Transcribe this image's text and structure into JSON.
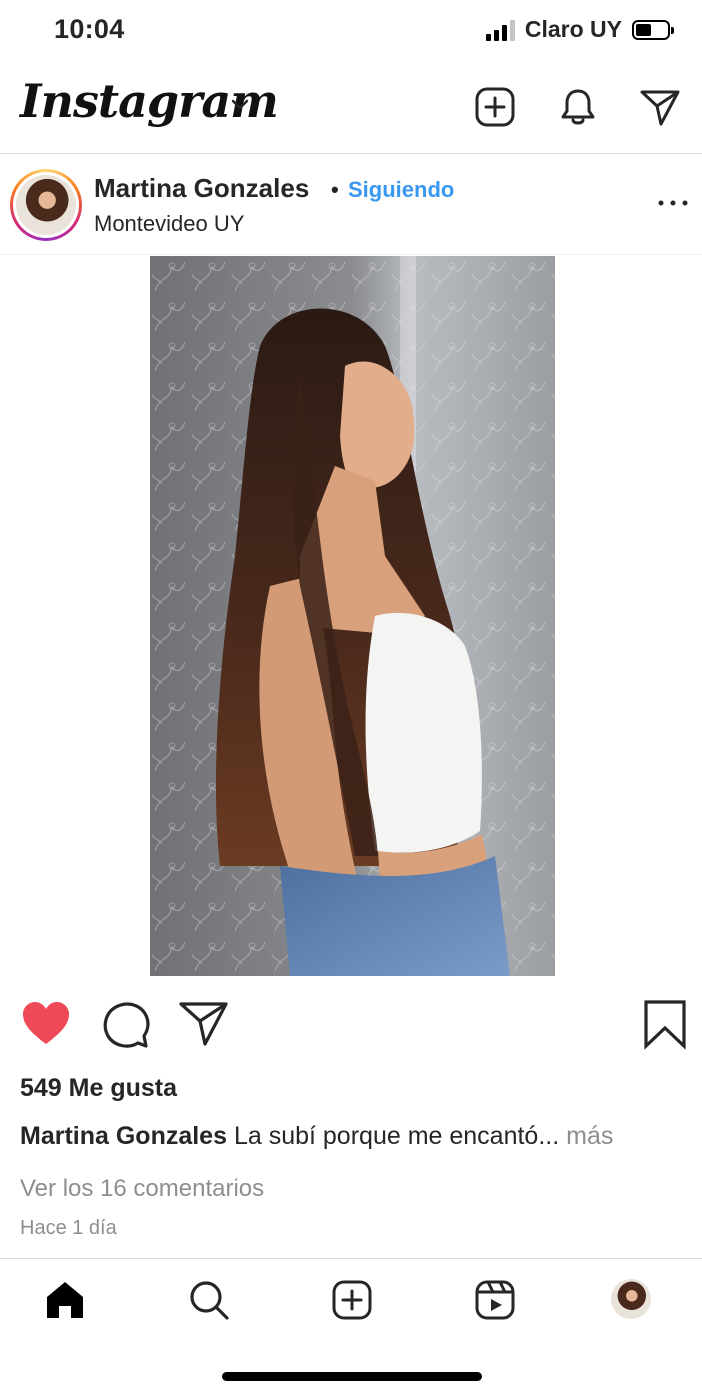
{
  "status_bar": {
    "time": "10:04",
    "carrier": "Claro UY",
    "battery_level_percent": 50
  },
  "header": {
    "logo_text": "Instagram",
    "icons": [
      "new-post-icon",
      "notifications-icon",
      "direct-messages-icon"
    ]
  },
  "post": {
    "username": "Martina Gonzales",
    "separator": "•",
    "follow_status": "Siguiendo",
    "location": "Montevideo UY",
    "likes": "549 Me gusta",
    "caption_user": "Martina Gonzales",
    "caption_text": "La subí porque me encantó...",
    "caption_more": "más",
    "comments_link": "Ver los 16 comentarios",
    "time_ago": "Hace 1 día",
    "liked": true
  },
  "tab_bar": {
    "items": [
      "home-icon",
      "search-icon",
      "new-post-icon",
      "reels-icon",
      "profile-avatar"
    ]
  },
  "colors": {
    "like_red": "#ed4956",
    "link_blue": "#3897f0",
    "secondary_gray": "#8e8e8e",
    "text": "#262626"
  }
}
